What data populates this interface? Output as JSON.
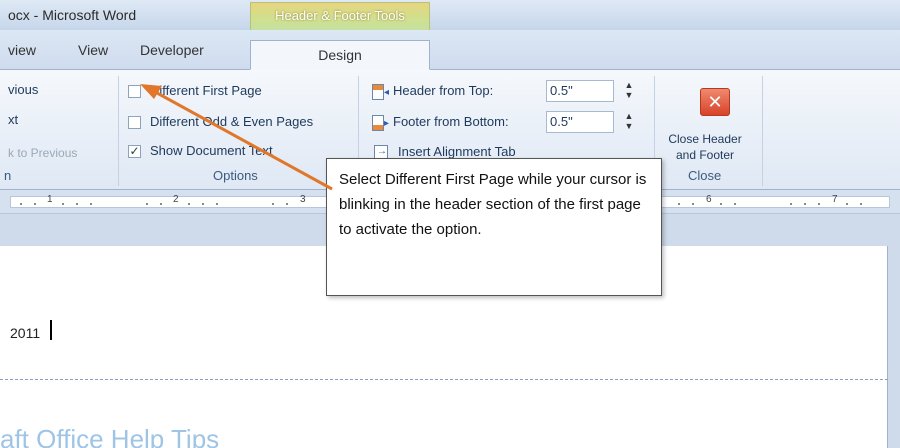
{
  "window": {
    "title": "ocx - Microsoft Word",
    "context_tab": "Header & Footer Tools"
  },
  "tabs": {
    "view_partial": "view",
    "view": "View",
    "developer": "Developer",
    "design": "Design"
  },
  "navigation": {
    "previous": "vious",
    "next": "xt",
    "link_to_previous": "k to Previous",
    "group_label": "n"
  },
  "options": {
    "different_first_page": "Different First Page",
    "different_odd_even": "Different Odd & Even Pages",
    "show_document_text": "Show Document Text",
    "show_document_text_checked": "✓",
    "group_label": "Options"
  },
  "position": {
    "header_from_top_label": "Header from Top:",
    "header_from_top_value": "0.5\"",
    "footer_from_bottom_label": "Footer from Bottom:",
    "footer_from_bottom_value": "0.5\"",
    "insert_alignment_tab": "Insert Alignment Tab"
  },
  "close": {
    "button_line1": "Close Header",
    "button_line2": "and Footer",
    "group_label": "Close",
    "icon": "close-icon"
  },
  "ruler": {
    "numbers": [
      "1",
      "2",
      "3",
      "6",
      "7"
    ]
  },
  "document": {
    "date_text": "2011",
    "heading_partial": "aft Office Help Tips"
  },
  "callout": {
    "text": "Select Different First Page while your cursor is blinking in the header section of the first page to activate the option."
  },
  "colors": {
    "arrow": "#e0772a",
    "context_tab": "#cfe08f"
  }
}
